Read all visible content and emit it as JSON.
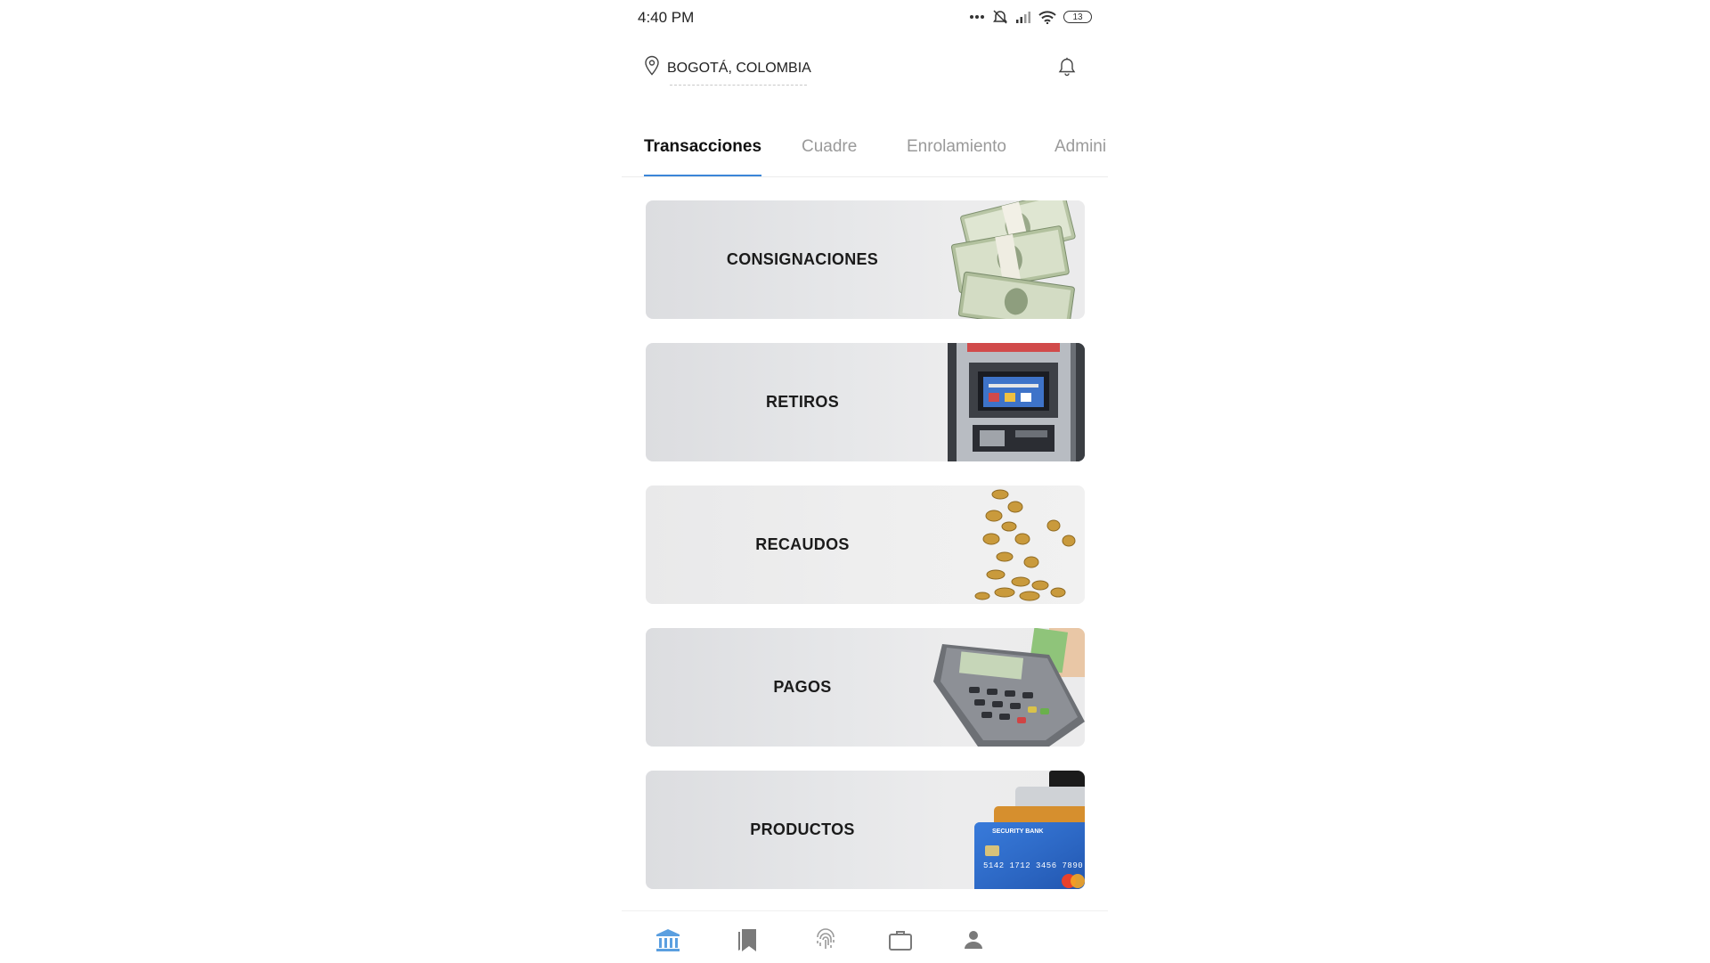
{
  "status_bar": {
    "time": "4:40 PM",
    "battery": "13"
  },
  "header": {
    "location": "BOGOTÁ, COLOMBIA"
  },
  "tabs": [
    {
      "label": "Transacciones",
      "active": true
    },
    {
      "label": "Cuadre",
      "active": false
    },
    {
      "label": "Enrolamiento",
      "active": false
    },
    {
      "label": "Admini",
      "active": false
    }
  ],
  "cards": [
    {
      "label": "CONSIGNACIONES",
      "art": "money-stack-image"
    },
    {
      "label": "RETIROS",
      "art": "atm-image"
    },
    {
      "label": "RECAUDOS",
      "art": "coins-image"
    },
    {
      "label": "PAGOS",
      "art": "card-terminal-image"
    },
    {
      "label": "PRODUCTOS",
      "art": "bank-cards-image",
      "card_bank": "SECURITY BANK",
      "card_number": "5142 1712 3456 7890"
    }
  ],
  "bottom_nav": [
    {
      "icon": "bank-icon",
      "active": true
    },
    {
      "icon": "bookmarks-icon",
      "active": false
    },
    {
      "icon": "fingerprint-icon",
      "active": false
    },
    {
      "icon": "briefcase-icon",
      "active": false
    },
    {
      "icon": "user-icon",
      "active": false
    }
  ],
  "colors": {
    "accent": "#3b86d8",
    "nav_active": "#5b9fe0",
    "nav_inactive": "#7a7a7a"
  }
}
